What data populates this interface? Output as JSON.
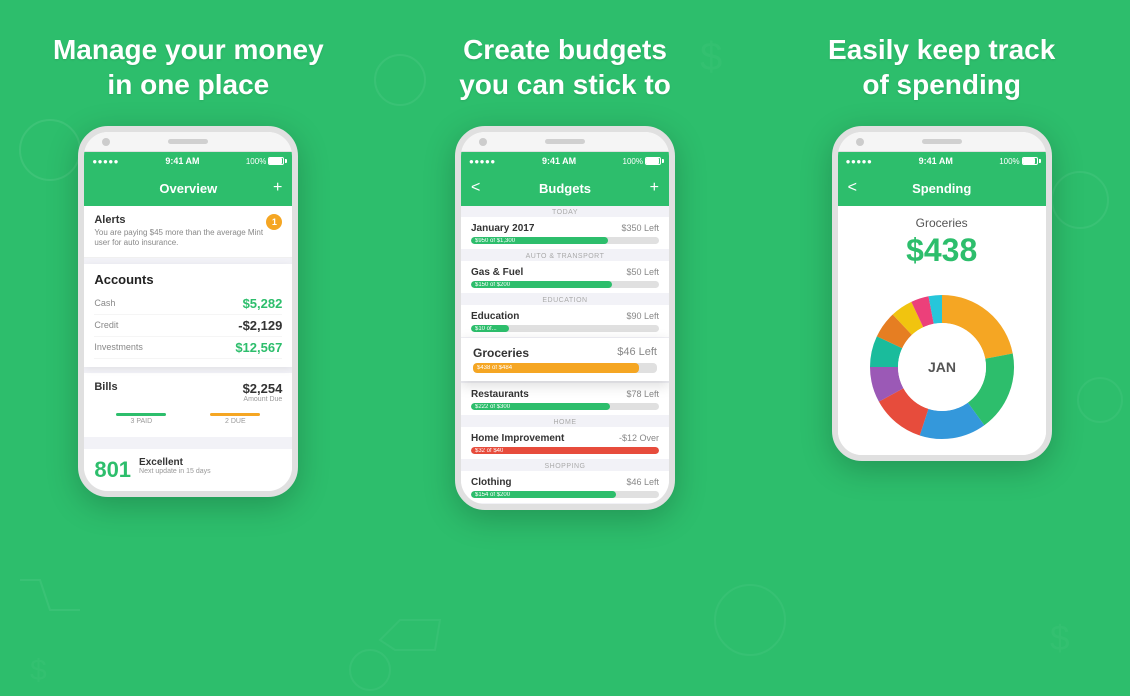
{
  "app": {
    "brand_color": "#2dbe6c",
    "bg_color": "#2dbe6c"
  },
  "panels": [
    {
      "id": "panel-1",
      "title_line1": "Manage your money",
      "title_line2": "in one place",
      "phone": {
        "status_time": "9:41 AM",
        "status_signal": "●●●●●",
        "status_battery": "100%",
        "nav_title": "Overview",
        "nav_right_icon": "+",
        "alerts": {
          "title": "Alerts",
          "text": "You are paying $45 more than the average Mint user for auto insurance.",
          "badge": "1"
        },
        "accounts": {
          "title": "Accounts",
          "rows": [
            {
              "label": "Cash",
              "value": "$5,282",
              "color": "green"
            },
            {
              "label": "Credit",
              "value": "-$2,129",
              "color": "dark"
            },
            {
              "label": "Investments",
              "value": "$12,567",
              "color": "green"
            }
          ]
        },
        "bills": {
          "title": "Bills",
          "amount": "$2,254",
          "due_label": "Amount Due",
          "bars": [
            {
              "label": "3 PAID",
              "color": "#2dbe6c",
              "pct": 0.7
            },
            {
              "label": "2 DUE",
              "color": "#f5a623",
              "pct": 0.5
            }
          ]
        },
        "credit_score": {
          "value": "801",
          "label": "Excellent",
          "sublabel": "Next update in 15 days"
        }
      }
    },
    {
      "id": "panel-2",
      "title_line1": "Create budgets",
      "title_line2": "you can stick to",
      "phone": {
        "status_time": "9:41 AM",
        "status_signal": "●●●●●",
        "status_battery": "100%",
        "nav_title": "Budgets",
        "nav_left_icon": "<",
        "nav_right_icon": "+",
        "budget_items": [
          {
            "name": "January 2017",
            "left": "$350 Left",
            "fill_label": "$950 of $1,300",
            "fill_pct": 0.73,
            "fill_color": "#2dbe6c",
            "sublabel": "TODAY",
            "highlighted": false
          },
          {
            "sublabel": "AUTO & TRANSPORT",
            "name": "Gas & Fuel",
            "left": "$50 Left",
            "fill_label": "$150 of $200",
            "fill_pct": 0.75,
            "fill_color": "#2dbe6c",
            "highlighted": false
          },
          {
            "sublabel": "EDUCATION",
            "name": "Education",
            "left": "$90 Left",
            "fill_label": "$10 of...",
            "fill_pct": 0.2,
            "fill_color": "#2dbe6c",
            "highlighted": false
          },
          {
            "name": "Groceries",
            "left": "$46 Left",
            "fill_label": "$438 of $484",
            "fill_pct": 0.9,
            "fill_color": "#f5a623",
            "highlighted": true
          },
          {
            "name": "Restaurants",
            "left": "$78 Left",
            "fill_label": "$222 of $300",
            "fill_pct": 0.74,
            "fill_color": "#2dbe6c",
            "highlighted": false
          },
          {
            "sublabel": "HOME",
            "name": "Home Improvement",
            "left": "-$12 Over",
            "fill_label": "$32 of $40",
            "fill_pct": 1.0,
            "fill_color": "#e74c3c",
            "highlighted": false
          },
          {
            "sublabel": "SHOPPING",
            "name": "Clothing",
            "left": "$46 Left",
            "fill_label": "$154 of $200",
            "fill_pct": 0.77,
            "fill_color": "#2dbe6c",
            "highlighted": false
          }
        ]
      }
    },
    {
      "id": "panel-3",
      "title_line1": "Easily keep track",
      "title_line2": "of spending",
      "phone": {
        "status_time": "9:41 AM",
        "status_signal": "●●●●●",
        "status_battery": "100%",
        "nav_title": "Spending",
        "nav_left_icon": "<",
        "spending": {
          "category": "Groceries",
          "amount": "$438",
          "chart_center_label": "JAN",
          "segments": [
            {
              "color": "#f5a623",
              "pct": 0.22
            },
            {
              "color": "#2dbe6c",
              "pct": 0.18
            },
            {
              "color": "#3498db",
              "pct": 0.15
            },
            {
              "color": "#e74c3c",
              "pct": 0.12
            },
            {
              "color": "#9b59b6",
              "pct": 0.08
            },
            {
              "color": "#1abc9c",
              "pct": 0.07
            },
            {
              "color": "#e67e22",
              "pct": 0.06
            },
            {
              "color": "#f1c40f",
              "pct": 0.05
            },
            {
              "color": "#ec407a",
              "pct": 0.04
            },
            {
              "color": "#26c6da",
              "pct": 0.03
            }
          ]
        }
      }
    }
  ]
}
